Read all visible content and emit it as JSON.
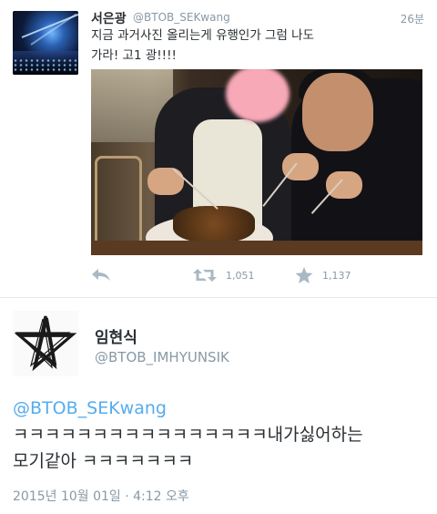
{
  "tweet1": {
    "name": "서은광",
    "handle": "@BTOB_SEKwang",
    "time": "26분",
    "text_line1": "지금 과거사진 올리는게 유행인가 그럼 나도",
    "text_line2": "가라! 고1 광!!!!",
    "retweets": "1,051",
    "favorites": "1,137",
    "icons": [
      "reply-icon",
      "retweet-icon",
      "favorite-icon"
    ]
  },
  "tweet2": {
    "name": "임현식",
    "handle": "@BTOB_IMHYUNSIK",
    "mention": "@BTOB_SEKwang",
    "text_line1": "ㅋㅋㅋㅋㅋㅋㅋㅋㅋㅋㅋㅋㅋㅋㅋㅋ내가싫어하는",
    "text_line2": "모기같아 ㅋㅋㅋㅋㅋㅋㅋ",
    "timestamp": "2015년 10월 01일 · 4:12 오후"
  },
  "colors": {
    "text": "#292f33",
    "muted": "#8899a6",
    "link": "#55acee",
    "divider": "#e1e8ed"
  }
}
